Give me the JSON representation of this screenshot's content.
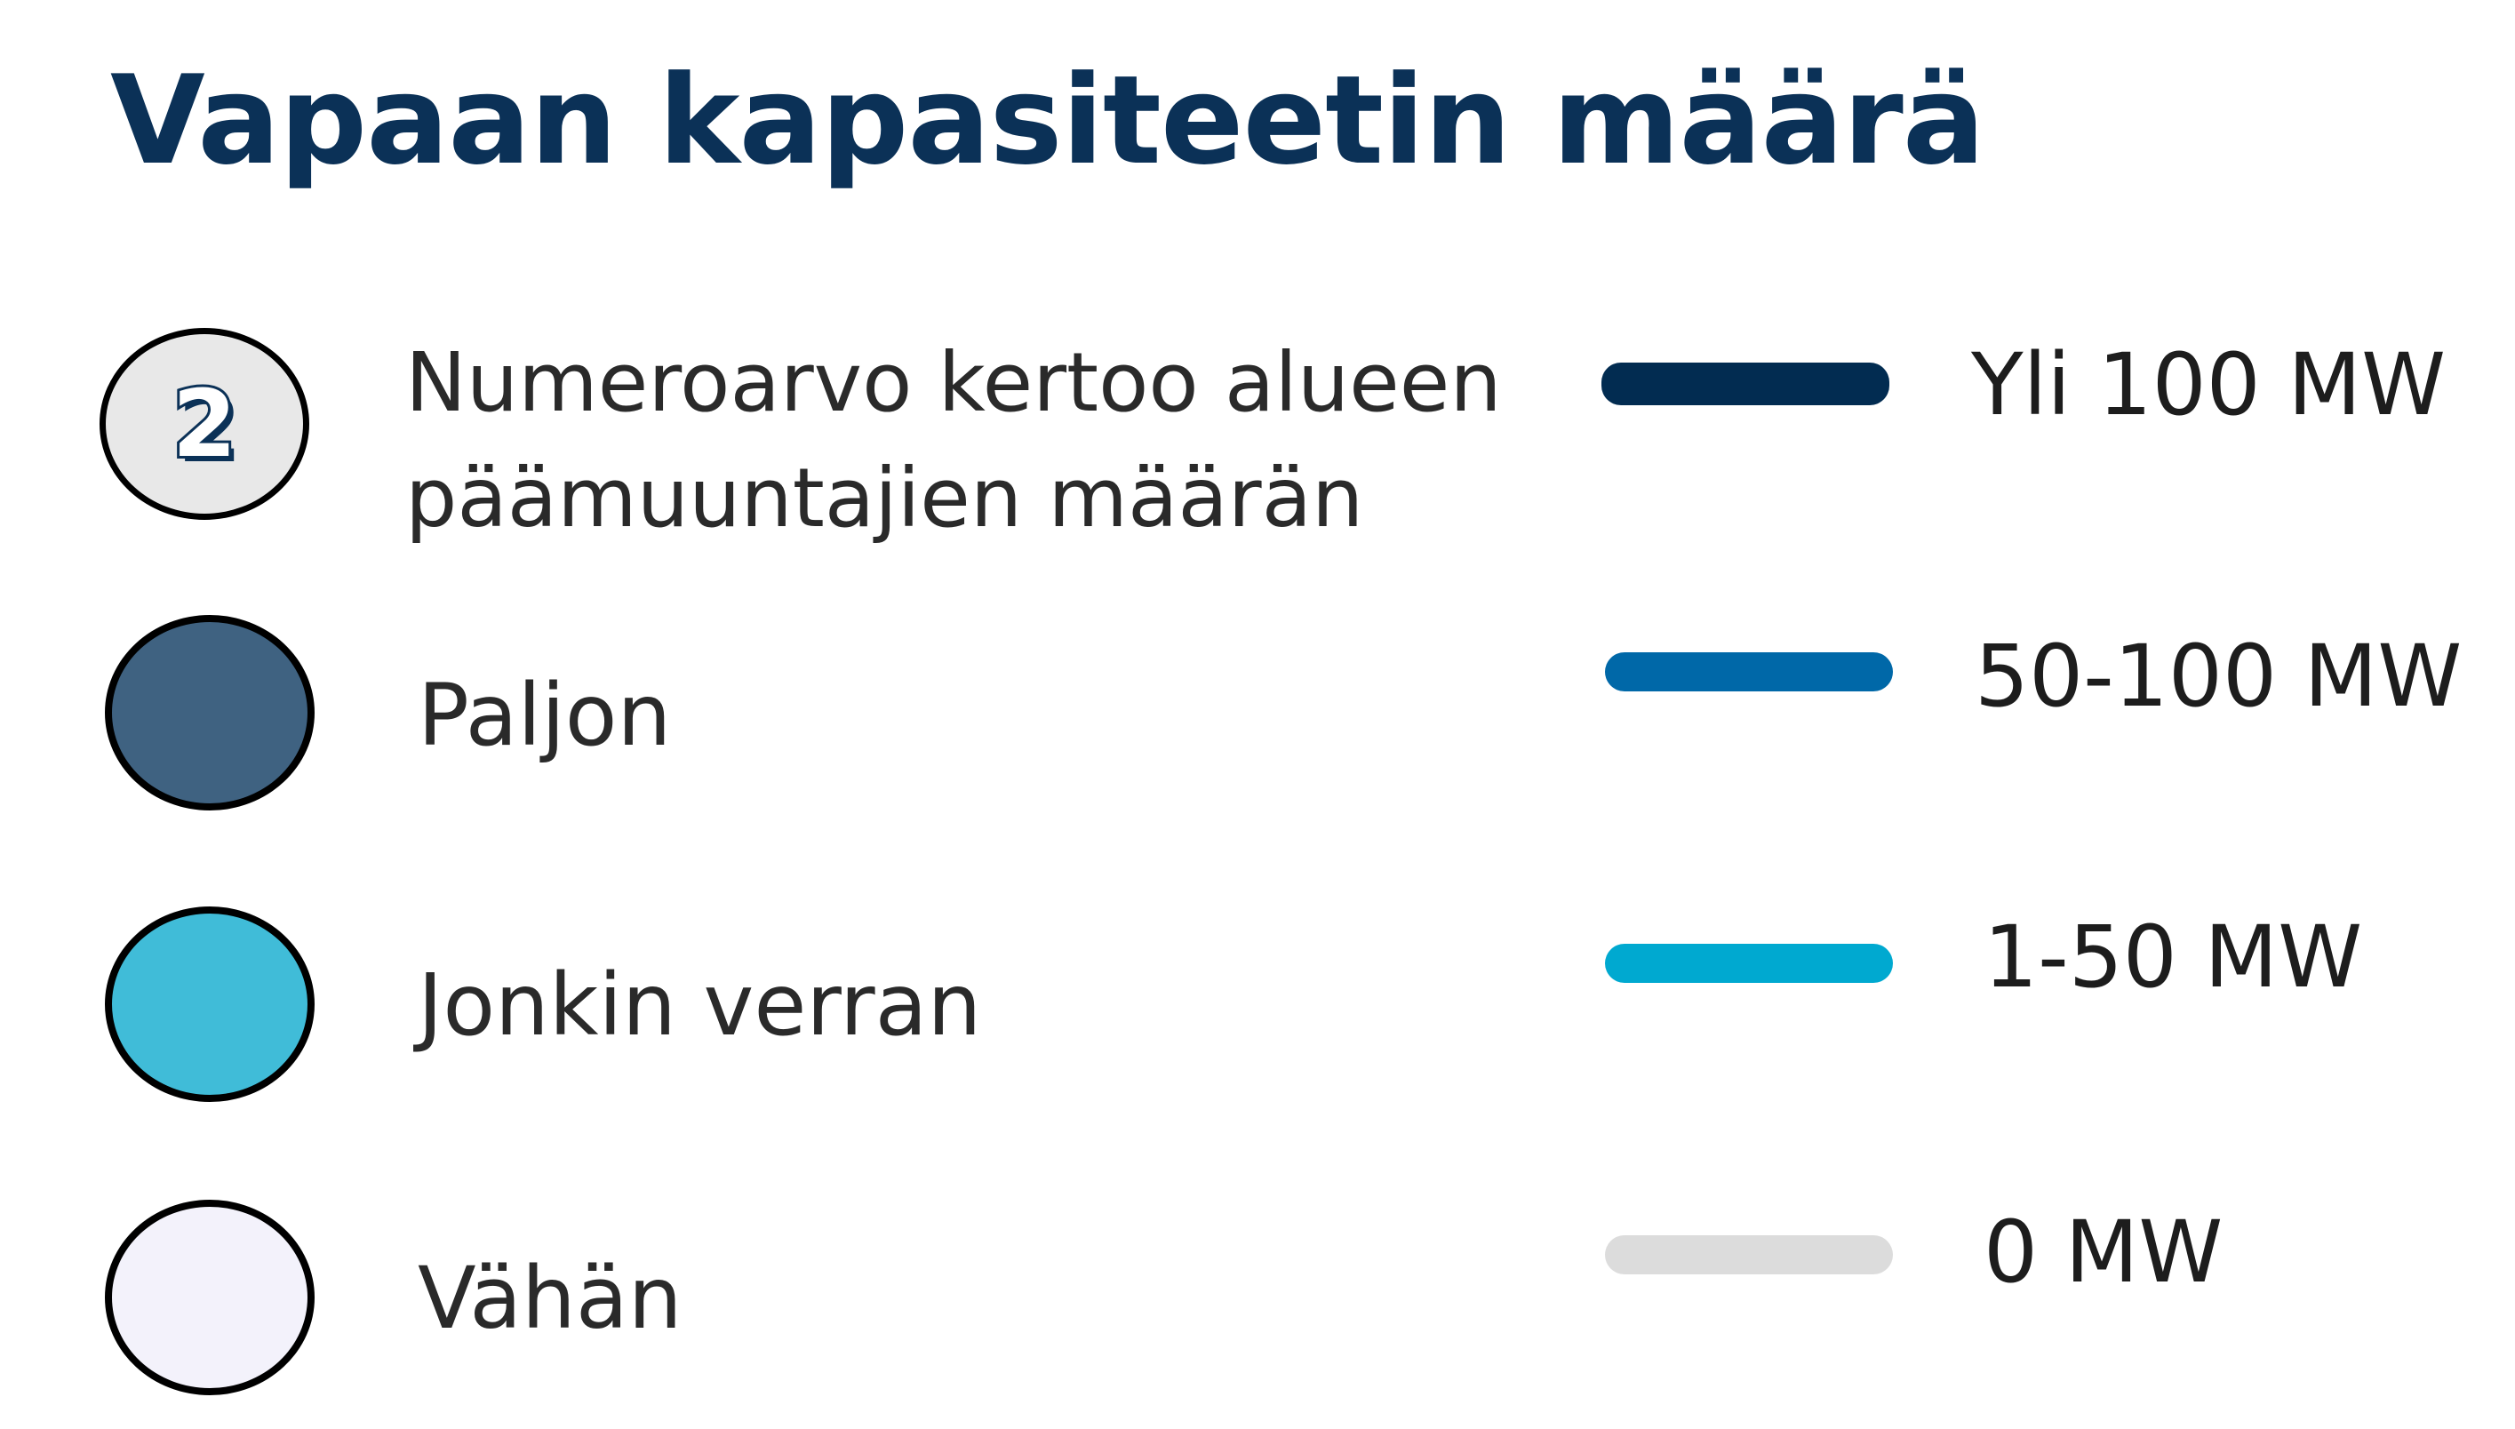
{
  "title": "Vapaan kapasiteetin määrä",
  "circle_legend": {
    "numbered": {
      "number": "2",
      "label": "Numeroarvo kertoo alueen päämuuntajien määrän",
      "fill": "#e8e8e8"
    },
    "items": [
      {
        "label": "Paljon",
        "fill": "#3f6281"
      },
      {
        "label": "Jonkin verran",
        "fill": "#40bcd8"
      },
      {
        "label": "Vähän",
        "fill": "#f3f2fb"
      }
    ]
  },
  "line_legend": {
    "items": [
      {
        "label": "Yli 100 MW",
        "color": "#022c51"
      },
      {
        "label": "50-100 MW",
        "color": "#0068a8"
      },
      {
        "label": "1-50 MW",
        "color": "#00a9d0"
      },
      {
        "label": "0 MW",
        "color": "#dcdcdc"
      }
    ]
  }
}
